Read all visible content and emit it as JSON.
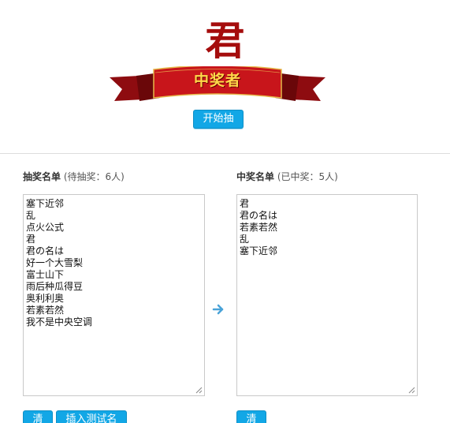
{
  "header": {
    "current_winner": "君",
    "ribbon_text": "中奖者",
    "start_button": "开始抽奖"
  },
  "pool": {
    "title": "抽奖名单",
    "status": "(待抽奖：6人)",
    "entries": [
      "塞下近邻",
      "乱",
      "点火公式",
      "君",
      "君の名は",
      "好一个大雪梨",
      "富士山下",
      "雨后种瓜得豆",
      "奥利利奥",
      "若素若然",
      "我不是中央空调"
    ],
    "clear_button": "清空",
    "insert_test_button": "插入测试名单"
  },
  "winners": {
    "title": "中奖名单",
    "status": "(已中奖：5人)",
    "entries": [
      "君",
      "君の名は",
      "若素若然",
      "乱",
      "塞下近邻"
    ],
    "clear_button": "清空"
  },
  "colors": {
    "accent": "#12a7e6",
    "winner_text": "#a50d0d",
    "ribbon": "#c8151b",
    "ribbon_text": "#ffd84a",
    "arrow": "#4aa3d8"
  },
  "icons": {
    "arrow": "arrow-right-icon",
    "resize": "resize-grip-icon"
  }
}
